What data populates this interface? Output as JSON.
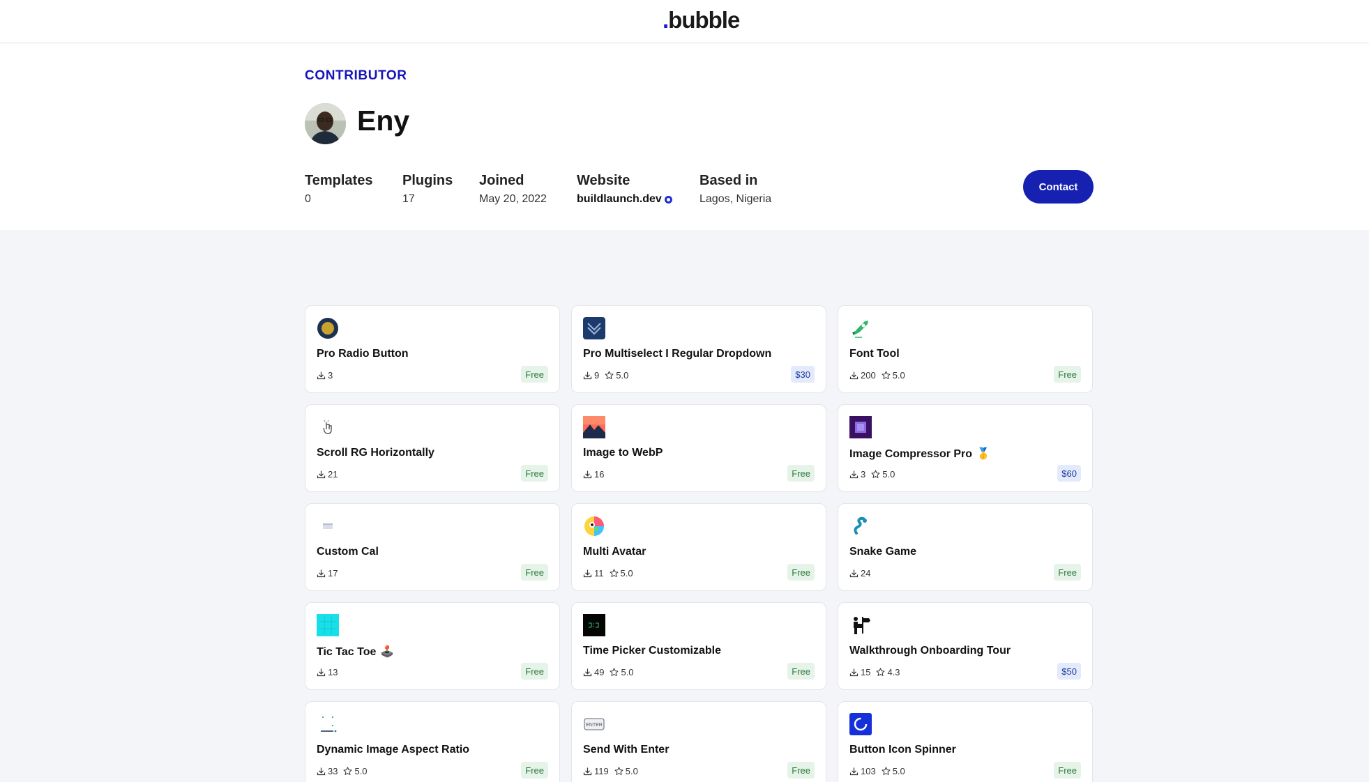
{
  "header": {
    "logo_text": "bubble"
  },
  "profile": {
    "kicker": "CONTRIBUTOR",
    "name": "Eny",
    "stats": [
      {
        "label": "Templates",
        "value": "0"
      },
      {
        "label": "Plugins",
        "value": "17"
      },
      {
        "label": "Joined",
        "value": "May 20, 2022"
      },
      {
        "label": "Website",
        "value": "buildlaunch.dev"
      },
      {
        "label": "Based in",
        "value": "Lagos, Nigeria"
      }
    ],
    "contact_label": "Contact"
  },
  "plugins": [
    {
      "title": "Pro Radio Button",
      "installs": "3",
      "rating": null,
      "price": "Free",
      "icon": "radio-button-icon"
    },
    {
      "title": "Pro Multiselect I Regular Dropdown",
      "installs": "9",
      "rating": "5.0",
      "price": "$30",
      "icon": "chevron-badge-icon"
    },
    {
      "title": "Font Tool",
      "installs": "200",
      "rating": "5.0",
      "price": "Free",
      "icon": "rocket-icon"
    },
    {
      "title": "Scroll RG Horizontally",
      "installs": "21",
      "rating": null,
      "price": "Free",
      "icon": "pointer-hand-icon"
    },
    {
      "title": "Image to WebP",
      "installs": "16",
      "rating": null,
      "price": "Free",
      "icon": "landscape-image-icon"
    },
    {
      "title": "Image Compressor Pro",
      "title_emoji": "🥇",
      "installs": "3",
      "rating": "5.0",
      "price": "$60",
      "icon": "compress-square-icon"
    },
    {
      "title": "Custom Cal",
      "installs": "17",
      "rating": null,
      "price": "Free",
      "icon": "calendar-icon"
    },
    {
      "title": "Multi Avatar",
      "installs": "11",
      "rating": "5.0",
      "price": "Free",
      "icon": "colorful-avatar-icon"
    },
    {
      "title": "Snake Game",
      "installs": "24",
      "rating": null,
      "price": "Free",
      "icon": "snake-icon"
    },
    {
      "title": "Tic Tac Toe",
      "title_emoji": "🕹️",
      "installs": "13",
      "rating": null,
      "price": "Free",
      "icon": "grid-board-icon"
    },
    {
      "title": "Time Picker Customizable",
      "installs": "49",
      "rating": "5.0",
      "price": "Free",
      "icon": "digital-clock-icon"
    },
    {
      "title": "Walkthrough Onboarding Tour",
      "installs": "15",
      "rating": "4.3",
      "price": "$50",
      "icon": "signpost-person-icon"
    },
    {
      "title": "Dynamic Image Aspect Ratio",
      "installs": "33",
      "rating": "5.0",
      "price": "Free",
      "icon": "aspect-ratio-icon"
    },
    {
      "title": "Send With Enter",
      "installs": "119",
      "rating": "5.0",
      "price": "Free",
      "icon": "enter-key-icon"
    },
    {
      "title": "Button Icon Spinner",
      "installs": "103",
      "rating": "5.0",
      "price": "Free",
      "icon": "spinner-icon"
    }
  ],
  "colors": {
    "brand": "#1621b2",
    "kicker": "#1613b8",
    "free_bg": "#e6f3e8",
    "free_text": "#2b7a3a",
    "paid_bg": "#e3eafb",
    "paid_text": "#1e3a9f",
    "page_bg": "#f4f5f8"
  }
}
